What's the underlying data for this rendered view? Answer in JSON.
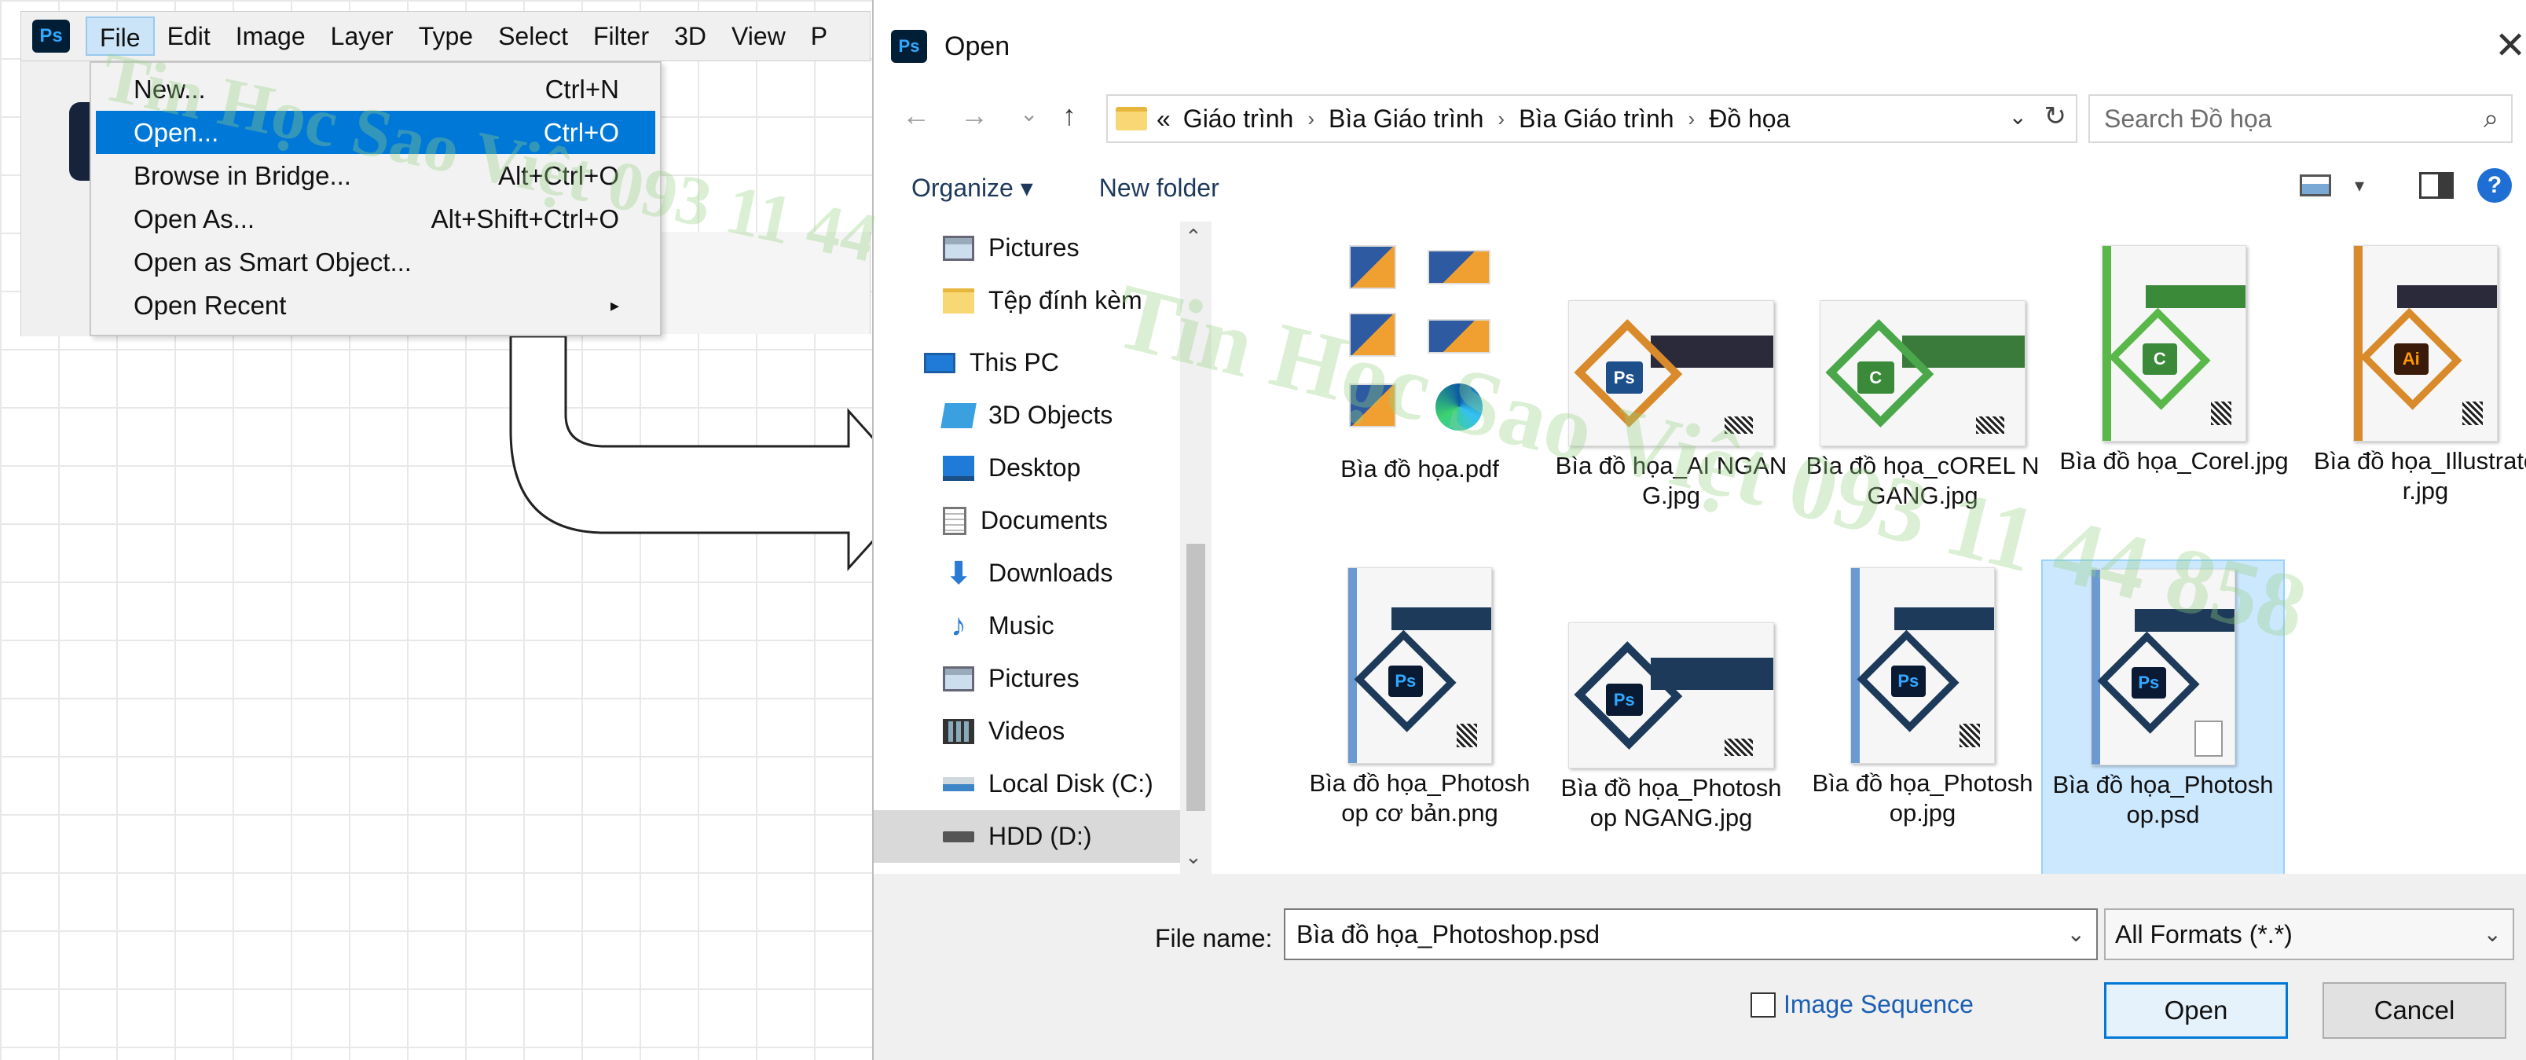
{
  "photoshop": {
    "logo": "Ps",
    "menus": [
      "File",
      "Edit",
      "Image",
      "Layer",
      "Type",
      "Select",
      "Filter",
      "3D",
      "View",
      "P"
    ],
    "file_menu": [
      {
        "label": "New...",
        "shortcut": "Ctrl+N"
      },
      {
        "label": "Open...",
        "shortcut": "Ctrl+O"
      },
      {
        "label": "Browse in Bridge...",
        "shortcut": "Alt+Ctrl+O"
      },
      {
        "label": "Open As...",
        "shortcut": "Alt+Shift+Ctrl+O"
      },
      {
        "label": "Open as Smart Object...",
        "shortcut": ""
      },
      {
        "label": "Open Recent",
        "shortcut": "▸"
      }
    ]
  },
  "watermark": "Tin Học Sao Việt 093 11 44 858",
  "dialog": {
    "logo": "Ps",
    "title": "Open",
    "close": "✕",
    "nav": {
      "back": "←",
      "forward": "→",
      "recent": "⌄",
      "up": "↑"
    },
    "address": {
      "prefix": "«",
      "crumbs": [
        "Giáo trình",
        "Bìa Giáo trình",
        "Bìa Giáo trình",
        "Đồ họa"
      ],
      "dropdown": "⌄",
      "refresh": "↻"
    },
    "search_placeholder": "Search Đồ họa",
    "search_icon": "⌕",
    "toolbar": {
      "organize": "Organize ▾",
      "new_folder": "New folder",
      "view_chevron": "▾",
      "help": "?"
    },
    "sidebar": [
      {
        "label": "Pictures",
        "icon": "pictures-icon"
      },
      {
        "label": "Tệp đính kèm",
        "icon": "folder-icon"
      },
      {
        "label": "This PC",
        "icon": "pc-icon"
      },
      {
        "label": "3D Objects",
        "icon": "3d-objects-icon"
      },
      {
        "label": "Desktop",
        "icon": "desktop-icon"
      },
      {
        "label": "Documents",
        "icon": "documents-icon"
      },
      {
        "label": "Downloads",
        "icon": "downloads-icon"
      },
      {
        "label": "Music",
        "icon": "music-icon"
      },
      {
        "label": "Pictures",
        "icon": "pictures-icon"
      },
      {
        "label": "Videos",
        "icon": "videos-icon"
      },
      {
        "label": "Local Disk (C:)",
        "icon": "local-disk-icon"
      },
      {
        "label": "HDD (D:)",
        "icon": "hdd-icon"
      }
    ],
    "files": [
      {
        "name": "Bìa đồ họa.pdf"
      },
      {
        "name": "Bìa đồ họa_AI NGANG.jpg"
      },
      {
        "name": "Bìa đồ họa_cOREL NGANG.jpg"
      },
      {
        "name": "Bìa đồ họa_Corel.jpg"
      },
      {
        "name": "Bìa đồ họa_Illustrator.jpg"
      },
      {
        "name": "Bìa đồ họa_Photoshop cơ bản.png"
      },
      {
        "name": "Bìa đồ họa_Photoshop NGANG.jpg"
      },
      {
        "name": "Bìa đồ họa_Photoshop.jpg"
      },
      {
        "name": "Bìa đồ họa_Photoshop.psd"
      }
    ],
    "cover_labels": {
      "ai": "Ai",
      "corel": "C",
      "ps": "Ps"
    },
    "filename_label": "File name:",
    "filename_value": "Bìa đồ họa_Photoshop.psd",
    "format": "All Formats (*.*)",
    "image_sequence": "Image Sequence",
    "open_button": "Open",
    "cancel_button": "Cancel",
    "colors": {
      "accent": "#0078d7",
      "selection": "#cce8ff"
    }
  }
}
